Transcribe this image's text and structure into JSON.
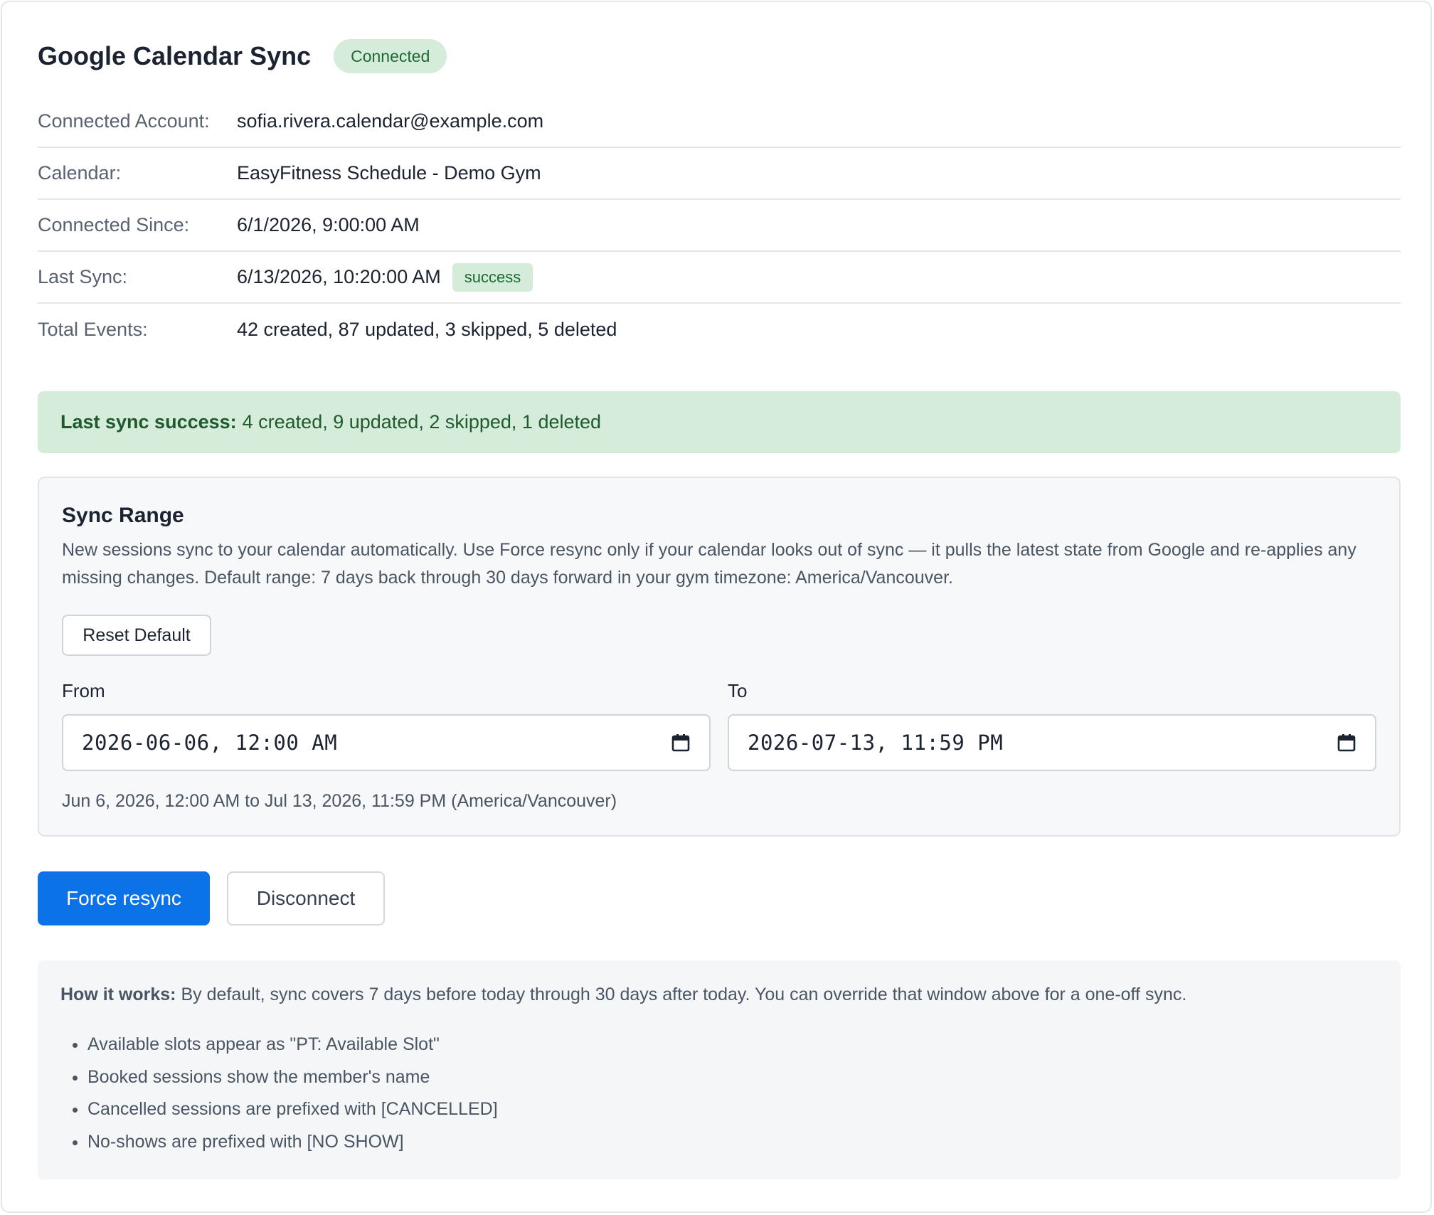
{
  "header": {
    "title": "Google Calendar Sync",
    "status_badge": "Connected"
  },
  "info_rows": [
    {
      "label": "Connected Account:",
      "value": "sofia.rivera.calendar@example.com"
    },
    {
      "label": "Calendar:",
      "value": "EasyFitness Schedule - Demo Gym"
    },
    {
      "label": "Connected Since:",
      "value": "6/1/2026, 9:00:00 AM"
    },
    {
      "label": "Last Sync:",
      "value": "6/13/2026, 10:20:00 AM",
      "badge": "success"
    },
    {
      "label": "Total Events:",
      "value": "42 created, 87 updated, 3 skipped, 5 deleted"
    }
  ],
  "alert": {
    "title": "Last sync success:",
    "message": "4 created, 9 updated, 2 skipped, 1 deleted"
  },
  "sync_range": {
    "title": "Sync Range",
    "description": "New sessions sync to your calendar automatically. Use Force resync only if your calendar looks out of sync — it pulls the latest state from Google and re-applies any missing changes. Default range: 7 days back through 30 days forward in your gym timezone: America/Vancouver.",
    "reset_label": "Reset Default",
    "from_label": "From",
    "from_value": "2026-06-06, 12:00 AM",
    "to_label": "To",
    "to_value": "2026-07-13, 11:59 PM",
    "range_summary": "Jun 6, 2026, 12:00 AM to Jul 13, 2026, 11:59 PM (America/Vancouver)"
  },
  "actions": {
    "force_resync_label": "Force resync",
    "disconnect_label": "Disconnect"
  },
  "how_it_works": {
    "title": "How it works:",
    "text": "By default, sync covers 7 days before today through 30 days after today. You can override that window above for a one-off sync.",
    "items": [
      "Available slots appear as \"PT: Available Slot\"",
      "Booked sessions show the member's name",
      "Cancelled sessions are prefixed with [CANCELLED]",
      "No-shows are prefixed with [NO SHOW]"
    ]
  },
  "colors": {
    "primary": "#0b72e7",
    "success_bg": "#d5ecdb",
    "success_text": "#1e6a33"
  },
  "icons": {
    "date_picker": "calendar-icon"
  }
}
